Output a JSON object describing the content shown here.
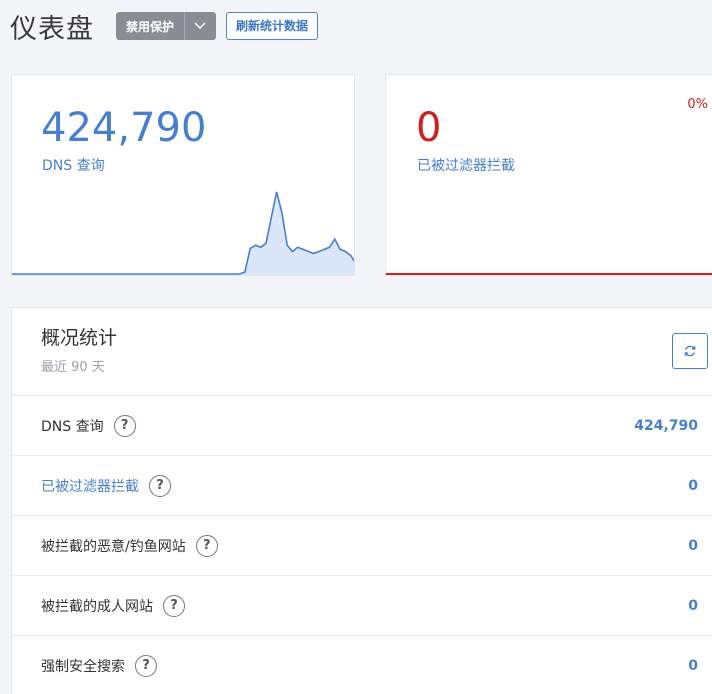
{
  "header": {
    "title": "仪表盘",
    "protect_button": "禁用保护",
    "refresh_stats_button": "刷新统计数据"
  },
  "cards": [
    {
      "value": "424,790",
      "label": "DNS 查询",
      "color": "#467fcf",
      "sparkline": [
        0,
        0,
        0,
        0,
        0,
        0,
        0,
        0,
        0,
        0,
        0,
        0,
        0,
        0,
        0,
        0,
        0,
        0,
        0,
        0,
        0,
        0,
        0,
        0,
        0,
        0,
        0,
        0,
        0,
        0,
        0,
        0,
        0,
        0,
        0,
        0,
        0,
        0,
        0,
        0,
        0,
        0,
        0,
        0,
        2,
        25,
        28,
        26,
        30,
        55,
        80,
        60,
        28,
        22,
        26,
        24,
        22,
        20,
        22,
        24,
        26,
        34,
        24,
        22,
        18,
        10
      ]
    },
    {
      "value": "0",
      "label": "已被过滤器拦截",
      "percent": "0%",
      "color": "#cd201f"
    }
  ],
  "overview": {
    "title": "概况统计",
    "subtitle": "最近 90 天",
    "rows": [
      {
        "label": "DNS 查询",
        "value": "424,790"
      },
      {
        "label": "已被过滤器拦截",
        "value": "0"
      },
      {
        "label": "被拦截的恶意/钓鱼网站",
        "value": "0"
      },
      {
        "label": "被拦截的成人网站",
        "value": "0"
      },
      {
        "label": "强制安全搜索",
        "value": "0"
      }
    ],
    "help_glyph": "?"
  }
}
